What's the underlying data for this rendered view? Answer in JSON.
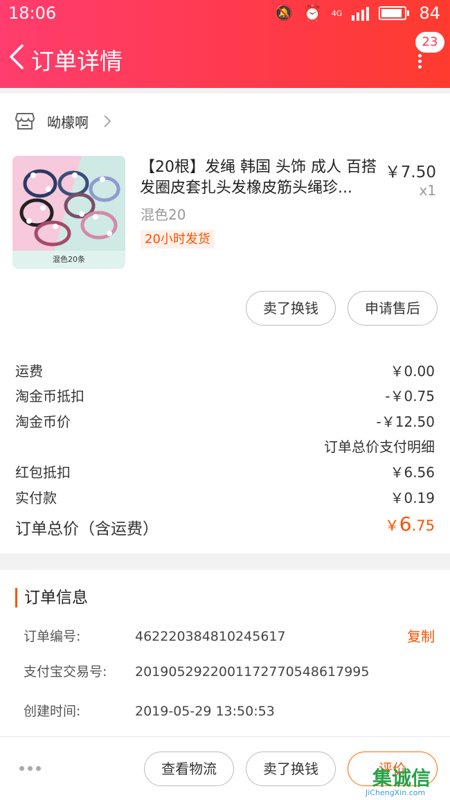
{
  "status_bar": {
    "time": "18:06",
    "network": "4G",
    "battery": "84"
  },
  "nav": {
    "title": "订单详情",
    "badge": "23"
  },
  "shop": {
    "name": "呦檬啊"
  },
  "product": {
    "title": "【20根】发绳 韩国 头饰 成人 百搭发圈皮套扎头发橡皮筋头绳珍...",
    "price": "￥7.50",
    "qty": "x1",
    "sku": "混色20",
    "tag": "20小时发货",
    "image_caption": "混色20条"
  },
  "product_actions": {
    "sell": "卖了换钱",
    "after_sales": "申请售后"
  },
  "fees": [
    {
      "label": "运费",
      "value": "￥0.00"
    },
    {
      "label": "淘金币抵扣",
      "value": "-￥0.75"
    },
    {
      "label": "淘金币价",
      "value": "-￥12.50"
    }
  ],
  "payment_detail_link": "订单总价支付明细",
  "payments": [
    {
      "label": "红包抵扣",
      "value": "￥6.56"
    },
    {
      "label": "实付款",
      "value": "￥0.19"
    }
  ],
  "total": {
    "label": "订单总价（含运费）",
    "currency": "￥",
    "integer": "6",
    "decimal": ".75"
  },
  "order_info": {
    "title": "订单信息",
    "rows": [
      {
        "key": "订单编号:",
        "value": "462220384810245617"
      },
      {
        "key": "支付宝交易号:",
        "value": "2019052922001172770548617995"
      },
      {
        "key": "创建时间:",
        "value": "2019-05-29 13:50:53"
      }
    ],
    "copy_label": "复制"
  },
  "bottom_bar": {
    "logistics": "查看物流",
    "sell": "卖了换钱",
    "review": "评价"
  },
  "watermark": {
    "cn": "集诚信",
    "en": "JiChengXin.com"
  }
}
